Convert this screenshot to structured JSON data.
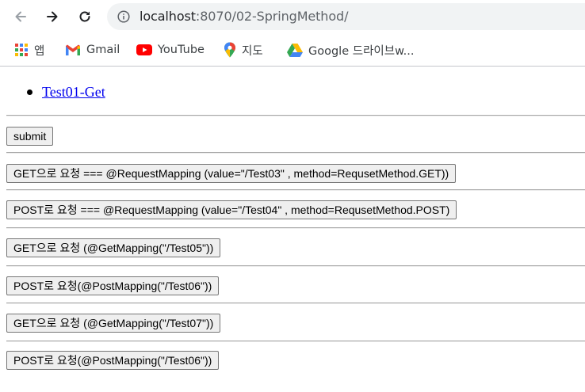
{
  "browser": {
    "url_host": "localhost",
    "url_path": ":8070/02-SpringMethod/"
  },
  "bookmarks": [
    {
      "label": "앱",
      "icon": "apps-grid-icon"
    },
    {
      "label": "Gmail",
      "icon": "gmail-icon"
    },
    {
      "label": "YouTube",
      "icon": "youtube-icon"
    },
    {
      "label": "지도",
      "icon": "maps-pin-icon"
    },
    {
      "label": "Google 드라이브w...",
      "icon": "google-drive-icon"
    }
  ],
  "page": {
    "link_label": "Test01-Get",
    "buttons": [
      "submit",
      "GET으로 요청 === @RequestMapping (value=\"/Test03\" , method=RequsetMethod.GET))",
      "POST로 요청 === @RequestMapping (value=\"/Test04\" , method=RequsetMethod.POST)",
      "GET으로 요청 (@GetMapping(\"/Test05\"))",
      "POST로 요청(@PostMapping(\"/Test06\"))",
      "GET으로 요청 (@GetMapping(\"/Test07\"))",
      "POST로 요청(@PostMapping(\"/Test06\"))"
    ]
  },
  "colors": {
    "link": "#0000ee",
    "omnibox_bg": "#f1f3f4",
    "button_bg": "#efefef",
    "youtube_red": "#ff0000"
  }
}
